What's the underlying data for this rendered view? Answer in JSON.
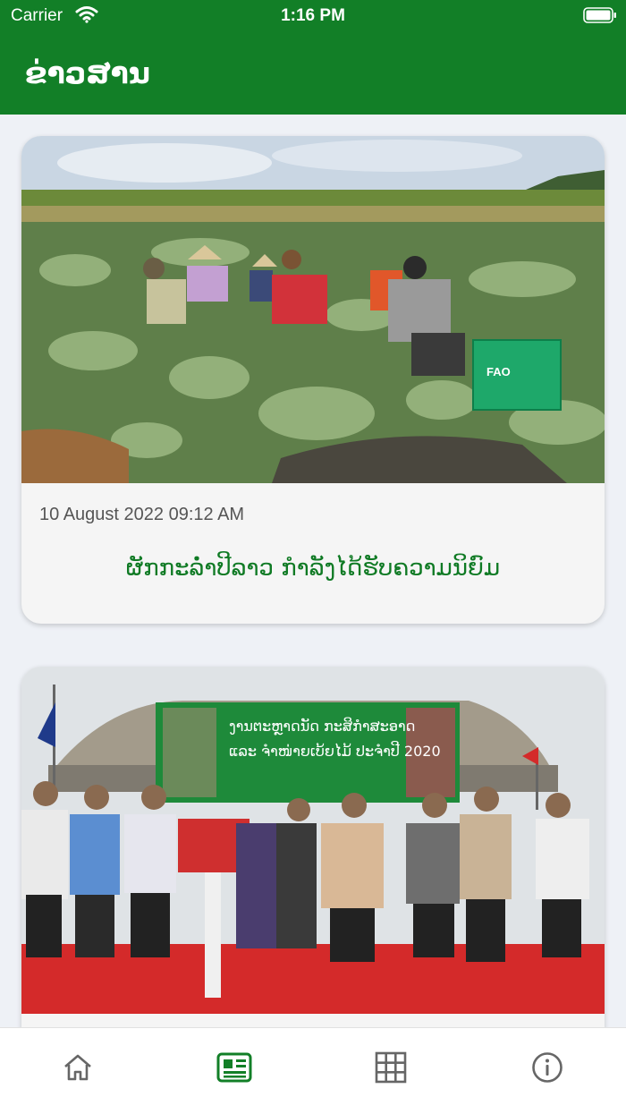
{
  "status_bar": {
    "carrier": "Carrier",
    "time": "1:16 PM"
  },
  "header": {
    "title": "ຂ່າວສານ"
  },
  "news": [
    {
      "date": "10 August 2022 09:12 AM",
      "headline": "ຜັກກະລໍ່າປີລາວ ກໍາລັງໄດ້ຮັບຄວາມນິຍົມ",
      "image_text": "FAO"
    },
    {
      "banner_line1": "ງານຕະຫຼາດນັດ ກະສິກໍາສະອາດ",
      "banner_line2": "ແລະ ຈໍາໜ່າຍເບ້ຍໄມ້ ປະຈໍາປີ 2020"
    }
  ],
  "tabs": [
    {
      "icon": "home-icon",
      "active": false
    },
    {
      "icon": "news-icon",
      "active": true
    },
    {
      "icon": "grid-icon",
      "active": false
    },
    {
      "icon": "info-icon",
      "active": false
    }
  ],
  "colors": {
    "primary": "#127f27",
    "inactive": "#666666"
  }
}
